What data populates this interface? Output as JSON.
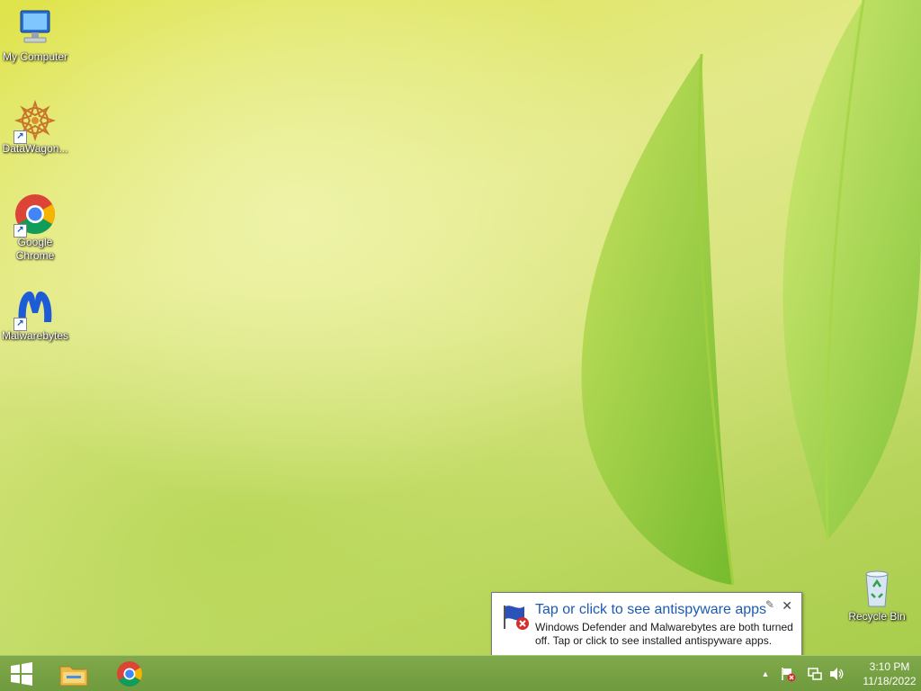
{
  "desktop": {
    "icons": [
      {
        "label": "My Computer"
      },
      {
        "label": "DataWagon..."
      },
      {
        "label": "Google Chrome"
      },
      {
        "label": "Malwarebytes"
      },
      {
        "label": "Recycle Bin"
      }
    ]
  },
  "notification": {
    "title": "Tap or click to see antispyware apps",
    "body": "Windows Defender and Malwarebytes are both turned off. Tap or click to see installed antispyware apps.",
    "close_glyph": "✕",
    "pin_glyph": "✎"
  },
  "taskbar": {
    "start_icon": "windows-logo-icon",
    "pinned": [
      {
        "name": "file-explorer",
        "icon": "folder-icon"
      },
      {
        "name": "google-chrome",
        "icon": "chrome-icon"
      }
    ],
    "tray": {
      "show_hidden_glyph": "▲",
      "icons": [
        "action-center-flag-icon",
        "network-icon",
        "volume-icon"
      ]
    },
    "clock": {
      "time": "3:10 PM",
      "date": "11/18/2022"
    }
  },
  "colors": {
    "taskbar": "#7fa94a",
    "notification_title": "#1c5bb0",
    "chrome_red": "#db4437",
    "chrome_green": "#0f9d58",
    "chrome_yellow": "#f4b400",
    "chrome_blue": "#4285f4"
  }
}
